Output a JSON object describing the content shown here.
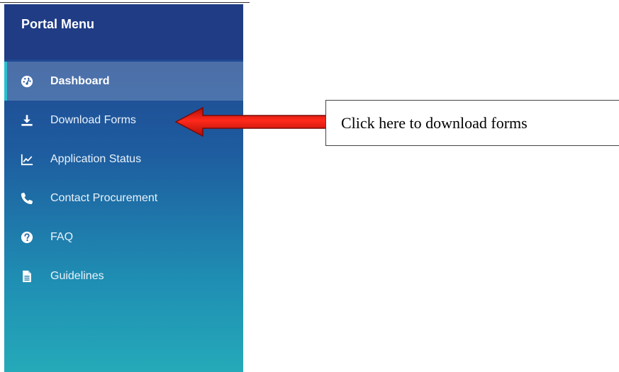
{
  "sidebar": {
    "title": "Portal Menu",
    "items": [
      {
        "label": "Dashboard",
        "icon": "gauge-icon",
        "active": true
      },
      {
        "label": "Download Forms",
        "icon": "download-icon",
        "active": false
      },
      {
        "label": "Application Status",
        "icon": "line-chart-icon",
        "active": false
      },
      {
        "label": "Contact Procurement",
        "icon": "phone-icon",
        "active": false
      },
      {
        "label": "FAQ",
        "icon": "question-circle-icon",
        "active": false
      },
      {
        "label": "Guidelines",
        "icon": "file-document-icon",
        "active": false
      }
    ]
  },
  "annotation": {
    "callout_text": "Click here to download forms",
    "arrow_color": "#e41a0e"
  },
  "colors": {
    "sidebar_top": "#223f8a",
    "sidebar_bottom": "#25aab9",
    "active_accent": "#28c0cf"
  }
}
